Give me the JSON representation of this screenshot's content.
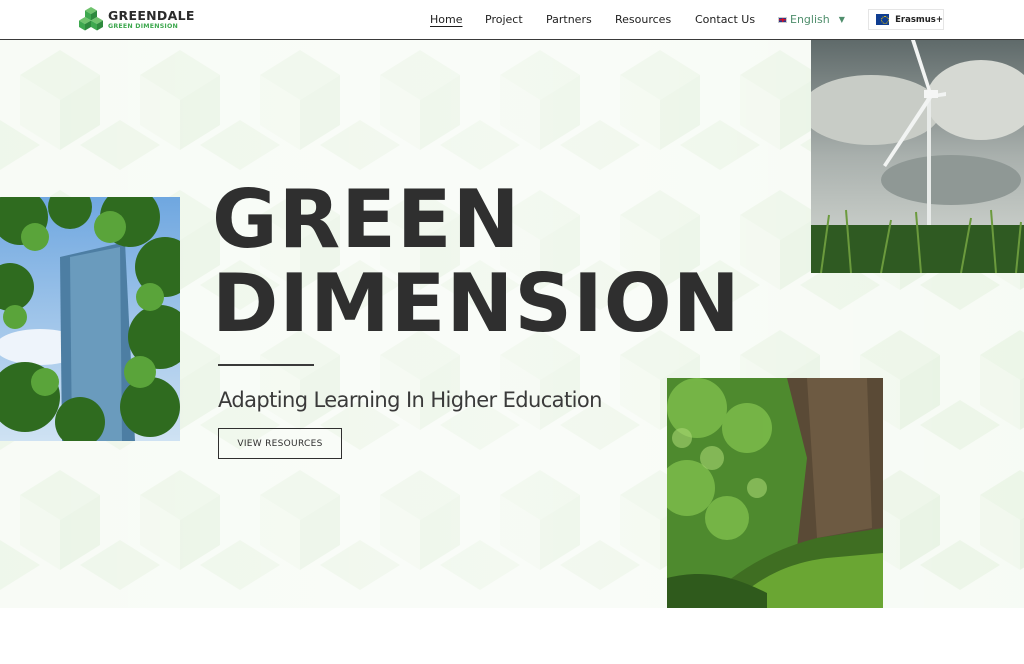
{
  "brand": {
    "name": "GREENDALE",
    "tagline": "GREEN DIMENSION"
  },
  "nav": {
    "items": [
      {
        "label": "Home",
        "active": true
      },
      {
        "label": "Project",
        "active": false
      },
      {
        "label": "Partners",
        "active": false
      },
      {
        "label": "Resources",
        "active": false
      },
      {
        "label": "Contact Us",
        "active": false
      }
    ],
    "language": "English",
    "erasmus_label": "Erasmus+"
  },
  "hero": {
    "title_line1": "GREEN",
    "title_line2": "DIMENSION",
    "subtitle": "Adapting Learning In Higher Education",
    "cta_label": "VIEW RESOURCES"
  },
  "icons": {
    "logo": "green-cube-logo-icon",
    "language_flag": "uk-flag-icon",
    "language_caret": "caret-down-icon",
    "erasmus_flag": "eu-flag-icon"
  },
  "colors": {
    "brand_green": "#3ea84f",
    "text_dark": "#2f2f2f",
    "lang_green": "#4f8e6c",
    "hero_bg": "#f5faf3"
  }
}
